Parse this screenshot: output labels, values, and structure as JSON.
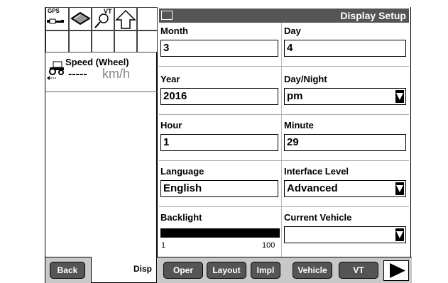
{
  "status_bar": {
    "gps_label": "GPS",
    "vt_label": "VT"
  },
  "speed": {
    "title": "Speed (Wheel)",
    "value": "-----",
    "unit": "km/h"
  },
  "header": {
    "title": "Display Setup"
  },
  "fields": {
    "month": {
      "label": "Month",
      "value": "3"
    },
    "day": {
      "label": "Day",
      "value": "4"
    },
    "year": {
      "label": "Year",
      "value": "2016"
    },
    "daynight": {
      "label": "Day/Night",
      "value": "pm"
    },
    "hour": {
      "label": "Hour",
      "value": "1"
    },
    "minute": {
      "label": "Minute",
      "value": "29"
    },
    "language": {
      "label": "Language",
      "value": "English"
    },
    "interface_level": {
      "label": "Interface Level",
      "value": "Advanced"
    },
    "backlight": {
      "label": "Backlight",
      "min": "1",
      "max": "100",
      "level_percent": 100
    },
    "current_vehicle": {
      "label": "Current Vehicle",
      "value": ""
    }
  },
  "softkeys": {
    "back": "Back",
    "disp": "Disp",
    "oper": "Oper",
    "layout": "Layout",
    "impl": "Impl",
    "vehicle": "Vehicle",
    "vt": "VT"
  },
  "colors": {
    "title_bg": "#555555",
    "softkey_bg": "#555555",
    "bottom_bar": "#c8c8c8"
  }
}
